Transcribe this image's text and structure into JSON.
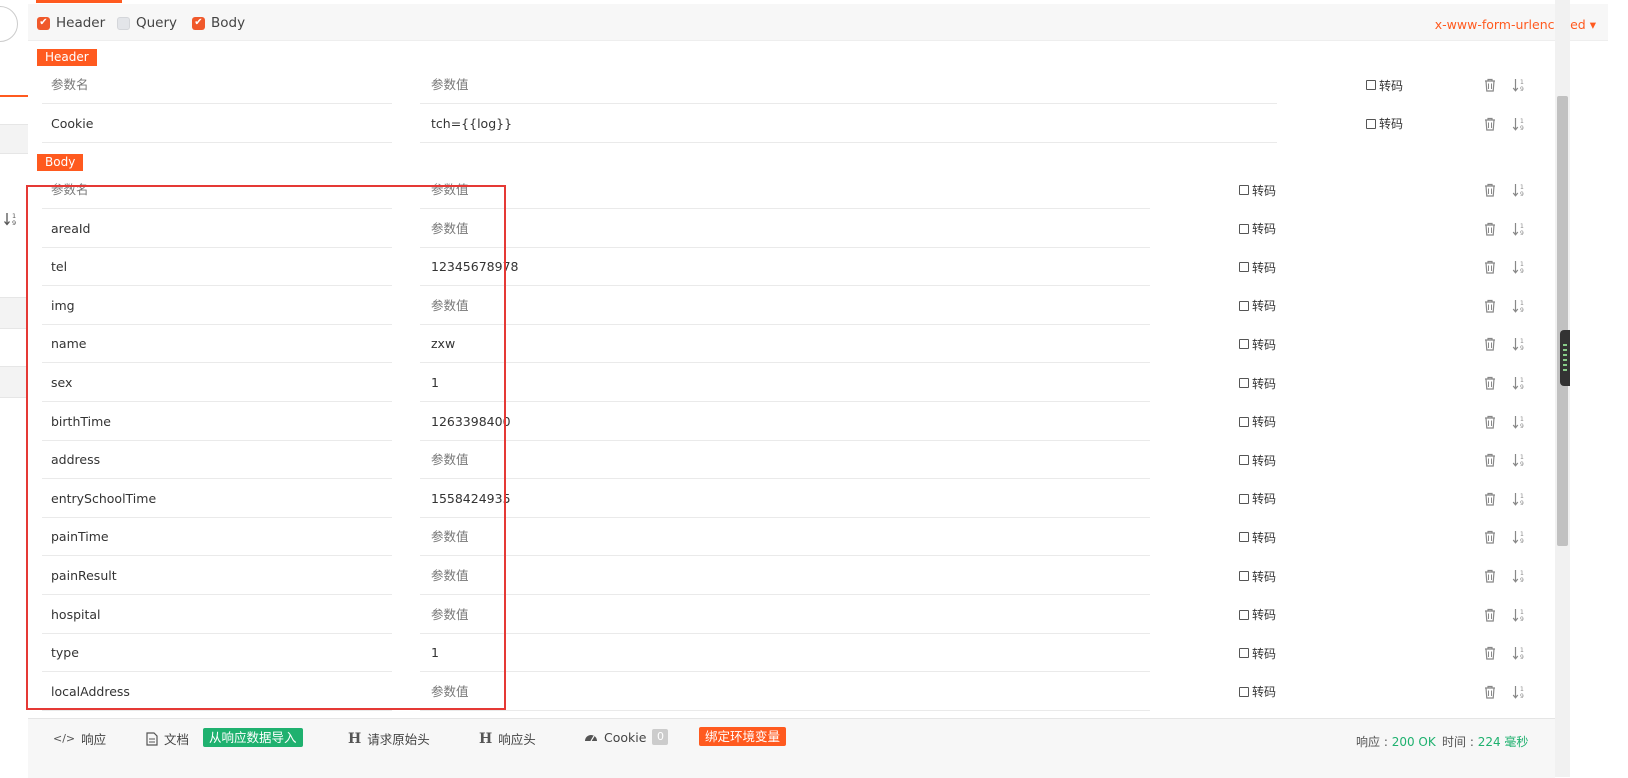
{
  "options": {
    "header_label": "Header",
    "query_label": "Query",
    "body_label": "Body",
    "header_checked": true,
    "query_checked": false,
    "body_checked": true,
    "content_type": "x-www-form-urlencoded"
  },
  "header_section": {
    "tag": "Header",
    "rows": [
      {
        "name": "参数名",
        "value": "参数值",
        "name_placeholder": true,
        "value_placeholder": true,
        "encode_label": "转码"
      },
      {
        "name": "Cookie",
        "value": "tch={{log}}",
        "name_placeholder": false,
        "value_placeholder": false,
        "encode_label": "转码"
      }
    ]
  },
  "body_section": {
    "tag": "Body",
    "rows": [
      {
        "name": "参数名",
        "value": "参数值",
        "name_placeholder": true,
        "value_placeholder": true,
        "encode_label": "转码"
      },
      {
        "name": "areaId",
        "value": "参数值",
        "name_placeholder": false,
        "value_placeholder": true,
        "encode_label": "转码"
      },
      {
        "name": "tel",
        "value": "12345678978",
        "name_placeholder": false,
        "value_placeholder": false,
        "encode_label": "转码"
      },
      {
        "name": "img",
        "value": "参数值",
        "name_placeholder": false,
        "value_placeholder": true,
        "encode_label": "转码"
      },
      {
        "name": "name",
        "value": "zxw",
        "name_placeholder": false,
        "value_placeholder": false,
        "encode_label": "转码"
      },
      {
        "name": "sex",
        "value": "1",
        "name_placeholder": false,
        "value_placeholder": false,
        "encode_label": "转码"
      },
      {
        "name": "birthTime",
        "value": "1263398400",
        "name_placeholder": false,
        "value_placeholder": false,
        "encode_label": "转码"
      },
      {
        "name": "address",
        "value": "参数值",
        "name_placeholder": false,
        "value_placeholder": true,
        "encode_label": "转码"
      },
      {
        "name": "entrySchoolTime",
        "value": "1558424935",
        "name_placeholder": false,
        "value_placeholder": false,
        "encode_label": "转码"
      },
      {
        "name": "painTime",
        "value": "参数值",
        "name_placeholder": false,
        "value_placeholder": true,
        "encode_label": "转码"
      },
      {
        "name": "painResult",
        "value": "参数值",
        "name_placeholder": false,
        "value_placeholder": true,
        "encode_label": "转码"
      },
      {
        "name": "hospital",
        "value": "参数值",
        "name_placeholder": false,
        "value_placeholder": true,
        "encode_label": "转码"
      },
      {
        "name": "type",
        "value": "1",
        "name_placeholder": false,
        "value_placeholder": false,
        "encode_label": "转码"
      },
      {
        "name": "localAddress",
        "value": "参数值",
        "name_placeholder": false,
        "value_placeholder": true,
        "encode_label": "转码"
      }
    ]
  },
  "bottom_bar": {
    "response_tab": "响应",
    "docs_tab": "文档",
    "import_button": "从响应数据导入",
    "raw_request_tab": "请求原始头",
    "response_headers_tab": "响应头",
    "cookie_tab": "Cookie",
    "cookie_count": "0",
    "bind_env_button": "绑定环境变量",
    "response_label": "响应 : ",
    "response_status": "200 OK",
    "time_label": "时间 : ",
    "time_value": "224 毫秒"
  },
  "icons": {
    "checkbox_checked": "checkmark-icon",
    "delete": "trash-icon",
    "sort": "sort-numeric-icon",
    "code": "code-icon",
    "document": "document-icon",
    "header_h": "h-icon",
    "cookie": "dashboard-icon",
    "dropdown": "caret-down-icon"
  },
  "colors": {
    "accent": "#ff5a1f",
    "success": "#1fb16f",
    "highlight_box": "#e53935"
  }
}
